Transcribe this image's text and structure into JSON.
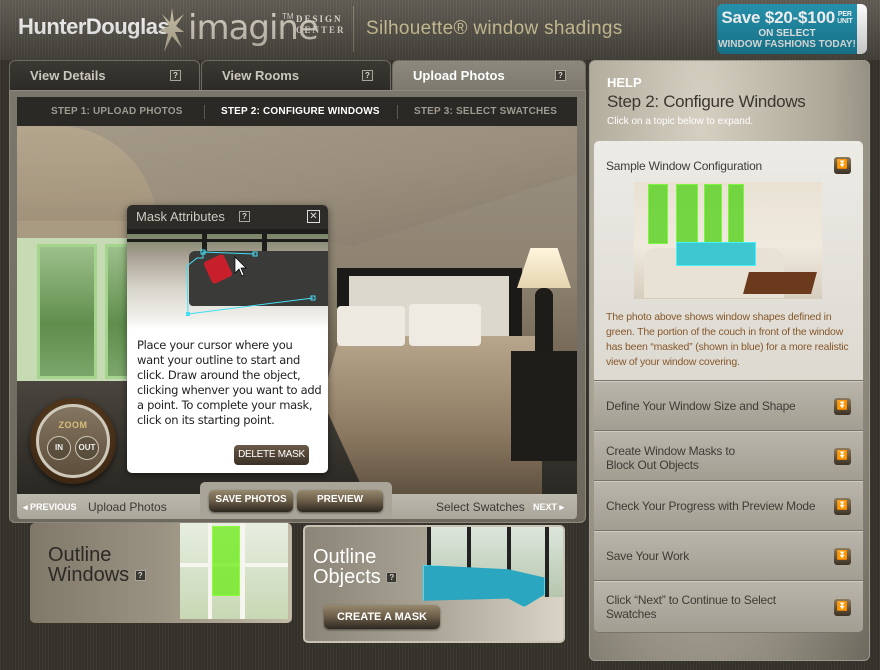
{
  "header": {
    "brand": "HunterDouglas",
    "logo_word": "imagine",
    "logo_tm": "TM",
    "logo_sub_line1": "DESIGN",
    "logo_sub_line2": "CENTER",
    "product": "Silhouette® window shadings",
    "promo": {
      "headline": "Save $20-$100",
      "per": "PER",
      "unit": "UNIT",
      "line2": "ON SELECT",
      "line3": "WINDOW FASHIONS TODAY!",
      "accent_color": "#1b8eaa"
    }
  },
  "tabs": [
    {
      "label": "View Details",
      "help": "?",
      "active": false
    },
    {
      "label": "View Rooms",
      "help": "?",
      "active": false
    },
    {
      "label": "Upload Photos",
      "help": "?",
      "active": true
    }
  ],
  "steps": [
    {
      "prefix": "STEP 1:",
      "label": "UPLOAD PHOTOS",
      "active": false
    },
    {
      "prefix": "STEP 2:",
      "label": "CONFIGURE WINDOWS",
      "active": true
    },
    {
      "prefix": "STEP 3:",
      "label": "SELECT SWATCHES",
      "active": false
    }
  ],
  "zoom": {
    "label": "ZOOM",
    "in": "IN",
    "out": "OUT"
  },
  "mask_dialog": {
    "title": "Mask Attributes",
    "help": "?",
    "close": "✕",
    "instructions": "Place your cursor where you want your outline to start and click. Draw around the object, clicking whenver you want to add a point. To complete your mask, click on its starting point.",
    "delete_button": "DELETE MASK"
  },
  "nav": {
    "previous": "◂ PREVIOUS",
    "previous_target": "Upload Photos",
    "save_photos": "SAVE PHOTOS",
    "preview": "PREVIEW",
    "next_target": "Select Swatches",
    "next": "NEXT ▸"
  },
  "cards": {
    "outline_windows": {
      "line1": "Outline",
      "line2": "Windows",
      "help": "?"
    },
    "outline_objects": {
      "line1": "Outline",
      "line2": "Objects",
      "help": "?",
      "button": "CREATE A MASK"
    }
  },
  "help": {
    "label": "HELP",
    "title": "Step 2: Configure Windows",
    "subtitle": "Click on a topic below to expand.",
    "topics": [
      {
        "title": "Sample Window Configuration",
        "expanded": true,
        "description": "The photo above shows window shapes defined in green. The portion of the couch in front of the window has been “masked” (shown in blue) for a more realistic view of your window covering."
      },
      {
        "title": "Define Your Window Size and Shape",
        "expanded": false
      },
      {
        "title_line1": "Create Window Masks to",
        "title_line2": "Block Out Objects",
        "expanded": false
      },
      {
        "title": "Check Your Progress with Preview Mode",
        "expanded": false
      },
      {
        "title": "Save Your Work",
        "expanded": false
      },
      {
        "title_line1": "Click “Next” to Continue to Select",
        "title_line2": "Swatches",
        "expanded": false
      }
    ],
    "expand_icon": "⏬"
  },
  "colors": {
    "window_outline_green": "#7ff542",
    "mask_outline_blue": "#44dff5",
    "help_description_text": "#87582a"
  }
}
